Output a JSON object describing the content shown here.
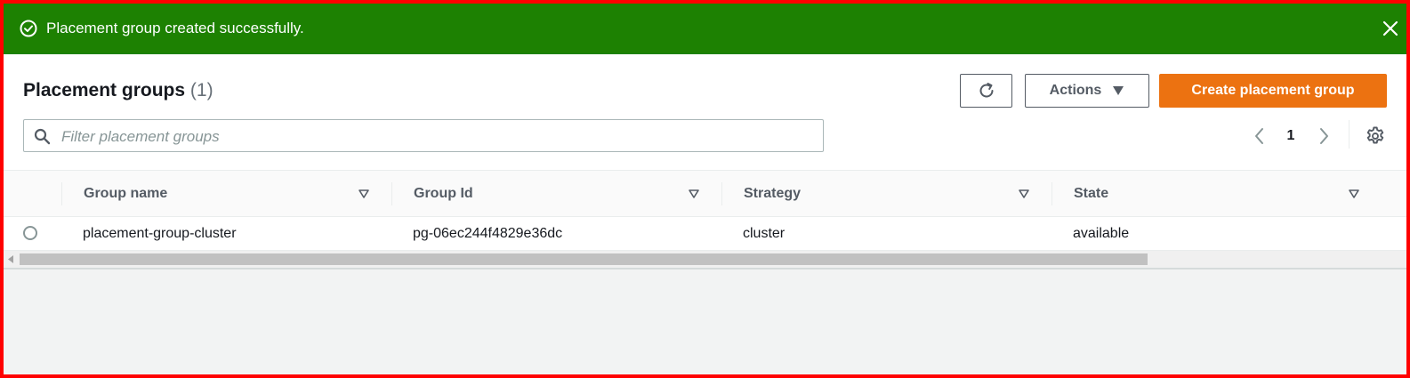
{
  "banner": {
    "message": "Placement group created successfully.",
    "color": "#1d8102"
  },
  "header": {
    "title": "Placement groups",
    "count": "(1)"
  },
  "toolbar": {
    "actions_label": "Actions",
    "create_label": "Create placement group",
    "accent": "#ec7211"
  },
  "filter": {
    "placeholder": "Filter placement groups",
    "value": ""
  },
  "pagination": {
    "page": "1"
  },
  "table": {
    "columns": [
      "Group name",
      "Group Id",
      "Strategy",
      "State"
    ],
    "rows": [
      {
        "group_name": "placement-group-cluster",
        "group_id": "pg-06ec244f4829e36dc",
        "strategy": "cluster",
        "state": "available"
      }
    ]
  },
  "icons": {
    "banner_status": "check-circle-icon",
    "banner_close": "close-icon",
    "refresh": "refresh-icon",
    "actions_dropdown": "caret-down-icon",
    "search": "search-icon",
    "prev": "chevron-left-icon",
    "next": "chevron-right-icon",
    "settings": "gear-icon",
    "sort": "sort-caret-icon"
  }
}
